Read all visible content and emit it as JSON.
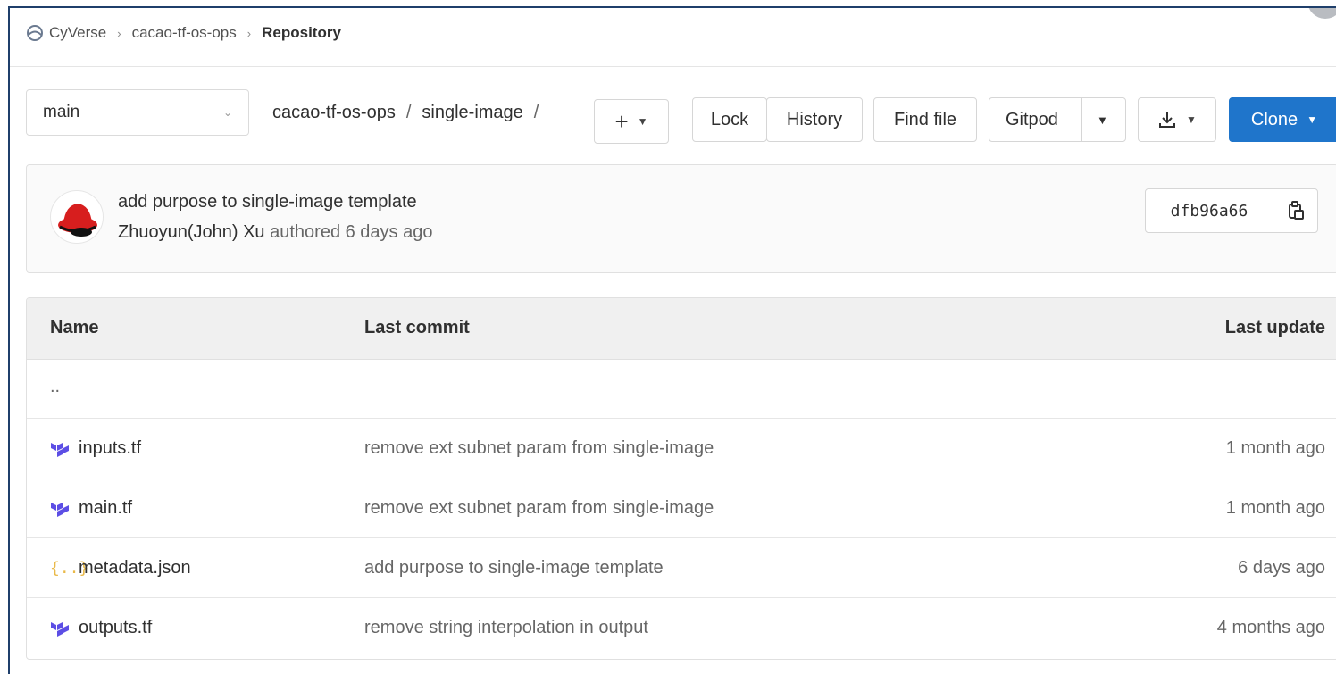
{
  "breadcrumb": {
    "items": [
      "CyVerse",
      "cacao-tf-os-ops",
      "Repository"
    ],
    "separator": "›"
  },
  "toolbar": {
    "branch": "main",
    "path": [
      "cacao-tf-os-ops",
      "single-image"
    ],
    "path_separator": "/",
    "add_label": "+",
    "lock_label": "Lock",
    "history_label": "History",
    "find_file_label": "Find file",
    "gitpod_label": "Gitpod",
    "clone_label": "Clone"
  },
  "commit": {
    "title": "add purpose to single-image template",
    "author": "Zhuoyun(John) Xu",
    "meta": "authored 6 days ago",
    "sha": "dfb96a66"
  },
  "table": {
    "headers": {
      "name": "Name",
      "last_commit": "Last commit",
      "last_update": "Last update"
    },
    "parent_label": "..",
    "rows": [
      {
        "name": "inputs.tf",
        "icon": "terraform-icon",
        "commit": "remove ext subnet param from single-image",
        "updated": "1 month ago"
      },
      {
        "name": "main.tf",
        "icon": "terraform-icon",
        "commit": "remove ext subnet param from single-image",
        "updated": "1 month ago"
      },
      {
        "name": "metadata.json",
        "icon": "json-icon",
        "commit": "add purpose to single-image template",
        "updated": "6 days ago"
      },
      {
        "name": "outputs.tf",
        "icon": "terraform-icon",
        "commit": "remove string interpolation in output",
        "updated": "4 months ago"
      }
    ]
  },
  "colors": {
    "accent": "#1f75cb",
    "terraform": "#5c4ee5",
    "json": "#e9b949"
  }
}
